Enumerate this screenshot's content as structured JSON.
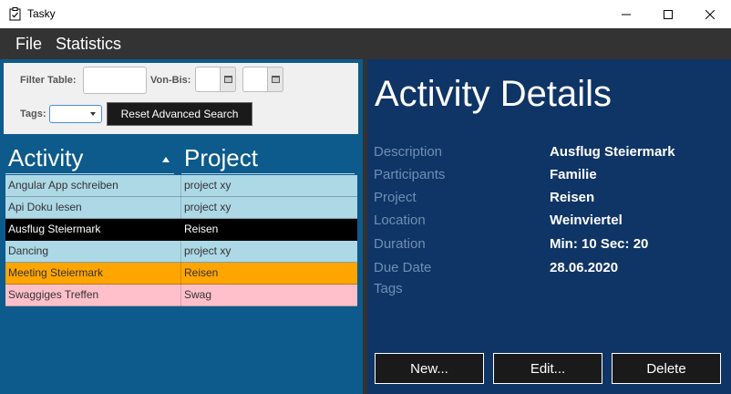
{
  "window": {
    "title": "Tasky",
    "app_icon": "clipboard-check-icon"
  },
  "menu": {
    "file": "File",
    "statistics": "Statistics"
  },
  "filters": {
    "filter_label": "Filter Table:",
    "range_label": "Von-Bis:",
    "tags_label": "Tags:",
    "reset_label": "Reset Advanced Search"
  },
  "table": {
    "col_activity": "Activity",
    "col_project": "Project",
    "sort": "ascending",
    "rows": [
      {
        "activity": "Angular App schreiben",
        "project": "project xy",
        "bg": "#add8e6",
        "fg": "#333333"
      },
      {
        "activity": "Api Doku lesen",
        "project": "project xy",
        "bg": "#add8e6",
        "fg": "#333333"
      },
      {
        "activity": "Ausflug Steiermark",
        "project": "Reisen",
        "bg": "#000000",
        "fg": "#ffffff"
      },
      {
        "activity": "Dancing",
        "project": "project xy",
        "bg": "#add8e6",
        "fg": "#333333"
      },
      {
        "activity": "Meeting Steiermark",
        "project": "Reisen",
        "bg": "#ffa500",
        "fg": "#333333"
      },
      {
        "activity": "Swaggiges Treffen",
        "project": "Swag",
        "bg": "#ffc0cb",
        "fg": "#333333"
      }
    ]
  },
  "details": {
    "title": "Activity Details",
    "description_label": "Description",
    "description_value": "Ausflug Steiermark",
    "participants_label": "Participants",
    "participants_value": "Familie",
    "project_label": "Project",
    "project_value": "Reisen",
    "location_label": "Location",
    "location_value": "Weinviertel",
    "duration_label": "Duration",
    "duration_value": "Min: 10 Sec: 20",
    "due_label": "Due Date",
    "due_value": "28.06.2020",
    "tags_label": "Tags"
  },
  "actions": {
    "new": "New...",
    "edit": "Edit...",
    "delete": "Delete"
  }
}
